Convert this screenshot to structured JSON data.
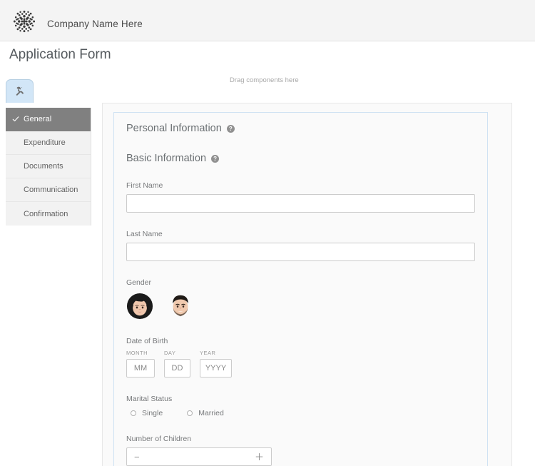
{
  "brand": {
    "logo_icon": "dot-circle-logo",
    "company_name": "Company Name Here"
  },
  "page": {
    "title": "Application Form",
    "drag_hint": "Drag components here"
  },
  "toolbar": {
    "tool_tab_icon": "wrench-icon"
  },
  "sidebar": {
    "items": [
      {
        "label": "General",
        "active": true,
        "check_icon": "check-icon"
      },
      {
        "label": "Expenditure",
        "active": false
      },
      {
        "label": "Documents",
        "active": false
      },
      {
        "label": "Communication",
        "active": false
      },
      {
        "label": "Confirmation",
        "active": false
      }
    ]
  },
  "form": {
    "section_title": "Personal Information",
    "section_help_icon": "question-mark-icon",
    "section_help_glyph": "?",
    "subsection_title": "Basic Information",
    "subsection_help_icon": "question-mark-icon",
    "subsection_help_glyph": "?",
    "first_name": {
      "label": "First Name",
      "value": "",
      "placeholder": ""
    },
    "last_name": {
      "label": "Last Name",
      "value": "",
      "placeholder": ""
    },
    "gender": {
      "label": "Gender",
      "options": [
        {
          "name": "female-avatar",
          "icon": "woman-face-icon"
        },
        {
          "name": "male-avatar",
          "icon": "man-face-icon"
        }
      ]
    },
    "date_of_birth": {
      "label": "Date of Birth",
      "month": {
        "caption": "MONTH",
        "placeholder": "MM",
        "value": ""
      },
      "day": {
        "caption": "DAY",
        "placeholder": "DD",
        "value": ""
      },
      "year": {
        "caption": "YEAR",
        "placeholder": "YYYY",
        "value": ""
      }
    },
    "marital_status": {
      "label": "Marital Status",
      "options": [
        {
          "label": "Single",
          "selected": false
        },
        {
          "label": "Married",
          "selected": false
        }
      ]
    },
    "number_of_children": {
      "label": "Number of Children",
      "value": "",
      "minus_glyph": "−",
      "plus_glyph": "＋"
    }
  },
  "colors": {
    "header_bg": "#f4f4f4",
    "nav_active_bg": "#808080",
    "panel_border": "#cfe2f3",
    "tool_tab_bg": "#d2e6f7"
  }
}
